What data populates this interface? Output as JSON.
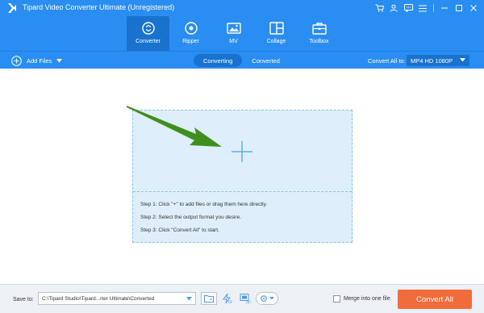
{
  "window": {
    "title": "Tipard Video Converter Ultimate (Unregistered)"
  },
  "nav": {
    "items": [
      {
        "label": "Converter",
        "icon": "converter-icon",
        "active": true
      },
      {
        "label": "Ripper",
        "icon": "ripper-icon",
        "active": false
      },
      {
        "label": "MV",
        "icon": "mv-icon",
        "active": false
      },
      {
        "label": "Collage",
        "icon": "collage-icon",
        "active": false
      },
      {
        "label": "Toolbox",
        "icon": "toolbox-icon",
        "active": false
      }
    ]
  },
  "toolbar": {
    "add_files_label": "Add Files",
    "tabs": [
      {
        "label": "Converting",
        "active": true
      },
      {
        "label": "Converted",
        "active": false
      }
    ],
    "convert_all_to_label": "Convert All to:",
    "format_value": "MP4 HD 1080P"
  },
  "dropzone": {
    "steps": [
      "Step 1: Click \"+\" to add files or drag them here directly.",
      "Step 2: Select the output format you desire.",
      "Step 3: Click \"Convert All\" to start."
    ]
  },
  "bottom": {
    "save_to_label": "Save to:",
    "path_value": "C:\\Tipard Studio\\Tipard...rter Ultimate\\Converted",
    "merge_label": "Merge into one file",
    "merge_checked": false,
    "convert_all_label": "Convert All"
  },
  "colors": {
    "header_blue": "#2a8df2",
    "active_blue": "#1a72cf",
    "convert_button": "#f26b3a",
    "arrow_green": "#3f8f1f"
  }
}
